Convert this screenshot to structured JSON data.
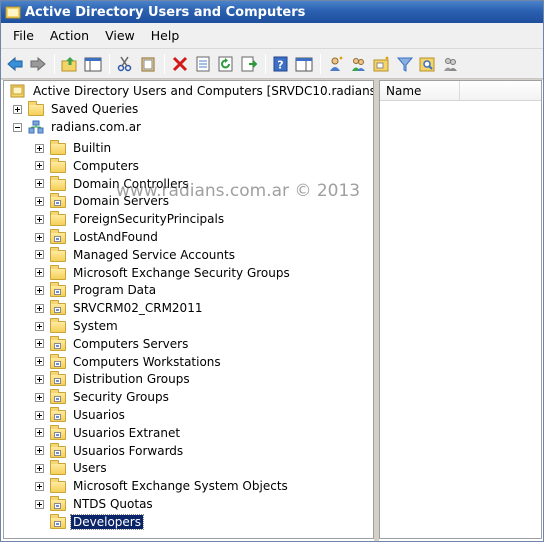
{
  "window": {
    "title": "Active Directory Users and Computers"
  },
  "menu": [
    "File",
    "Action",
    "View",
    "Help"
  ],
  "toolbar": {
    "buttons": [
      "back-icon",
      "forward-icon",
      "up-folder-icon",
      "show-console-tree-icon",
      "cut-icon",
      "copy-icon",
      "delete-icon",
      "properties-icon",
      "refresh-icon",
      "export-list-icon",
      "help-icon",
      "console-icon",
      "new-user-icon",
      "new-group-icon",
      "new-ou-icon",
      "filter-icon",
      "find-icon",
      "add-to-group-icon"
    ]
  },
  "tree": {
    "root": "Active Directory Users and Computers [SRVDC10.radians.com.a",
    "saved_queries": "Saved Queries",
    "domain": "radians.com.ar",
    "children": [
      "Builtin",
      "Computers",
      "Domain Controllers",
      "Domain Servers",
      "ForeignSecurityPrincipals",
      "LostAndFound",
      "Managed Service Accounts",
      "Microsoft Exchange Security Groups",
      "Program Data",
      "SRVCRM02_CRM2011",
      "System",
      "Computers Servers",
      "Computers Workstations",
      "Distribution Groups",
      "Security Groups",
      "Usuarios",
      "Usuarios Extranet",
      "Usuarios Forwards",
      "Users",
      "Microsoft Exchange System Objects",
      "NTDS Quotas",
      "Developers"
    ]
  },
  "list": {
    "column_name": "Name"
  },
  "watermark": "www.radians.com.ar © 2013",
  "colors": {
    "title_bar": "#2a60b0",
    "selection": "#0a246a"
  }
}
